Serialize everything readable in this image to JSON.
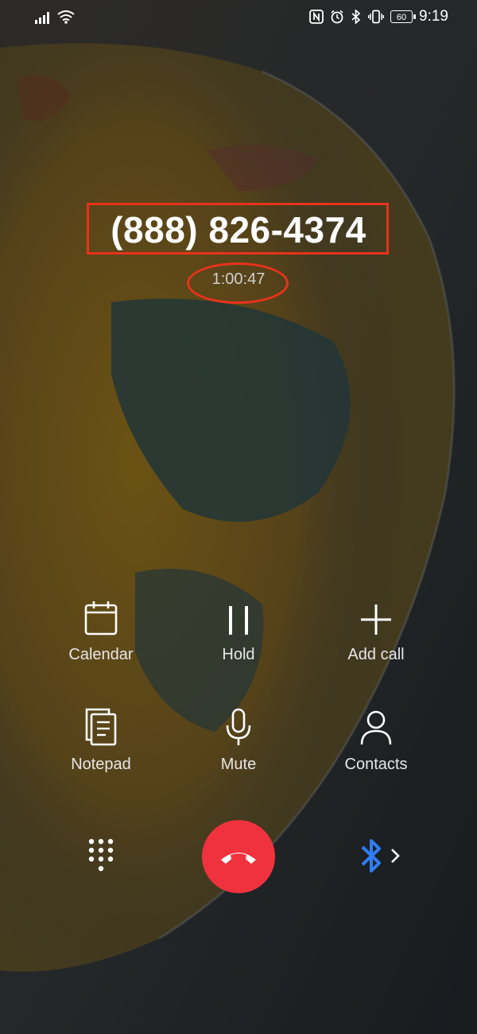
{
  "status_bar": {
    "time": "9:19",
    "battery": "60",
    "icons": [
      "signal-icon",
      "wifi-icon",
      "nfc-icon",
      "alarm-icon",
      "bluetooth-icon",
      "vibrate-icon",
      "battery-icon"
    ]
  },
  "call": {
    "number": "(888) 826-4374",
    "duration": "1:00:47"
  },
  "controls": {
    "calendar": {
      "label": "Calendar",
      "icon": "calendar-icon"
    },
    "hold": {
      "label": "Hold",
      "icon": "pause-icon"
    },
    "add_call": {
      "label": "Add call",
      "icon": "plus-icon"
    },
    "notepad": {
      "label": "Notepad",
      "icon": "notepad-icon"
    },
    "mute": {
      "label": "Mute",
      "icon": "microphone-icon"
    },
    "contacts": {
      "label": "Contacts",
      "icon": "person-icon"
    }
  },
  "bottom": {
    "dialpad_icon": "dialpad-icon",
    "end_call_icon": "hang-up-icon",
    "bluetooth_icon": "bluetooth-icon"
  },
  "colors": {
    "end_call": "#f0323e",
    "annotation": "#e8321c",
    "bluetooth": "#2f7df4"
  }
}
